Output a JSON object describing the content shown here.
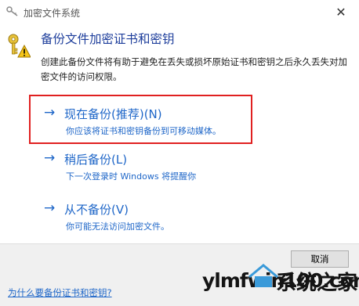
{
  "window": {
    "title": "加密文件系统",
    "close_glyph": "✕"
  },
  "header": {
    "title": "备份文件加密证书和密钥",
    "description": "创建此备份文件将有助于避免在丢失或损坏原始证书和密钥之后永久丢失对加密文件的访问权限。"
  },
  "options": [
    {
      "label": "现在备份(推荐)(N)",
      "desc": "你应该将证书和密钥备份到可移动媒体。",
      "highlighted": true
    },
    {
      "label": "稍后备份(L)",
      "desc": "下一次登录时 Windows 将提醒你"
    },
    {
      "label": "从不备份(V)",
      "desc": "你可能无法访问加密文件。"
    }
  ],
  "arrow_glyph": "→",
  "footer": {
    "cancel_label": "取消",
    "help_link": "为什么要备份证书和密钥?"
  },
  "watermark": {
    "text": "ylmfwin100.com",
    "cn_text": "系统之家"
  },
  "colors": {
    "accent": "#1e66c8",
    "title": "#1f3f9c",
    "highlight_border": "#e02020",
    "footer_bg": "#f0f0f0"
  }
}
